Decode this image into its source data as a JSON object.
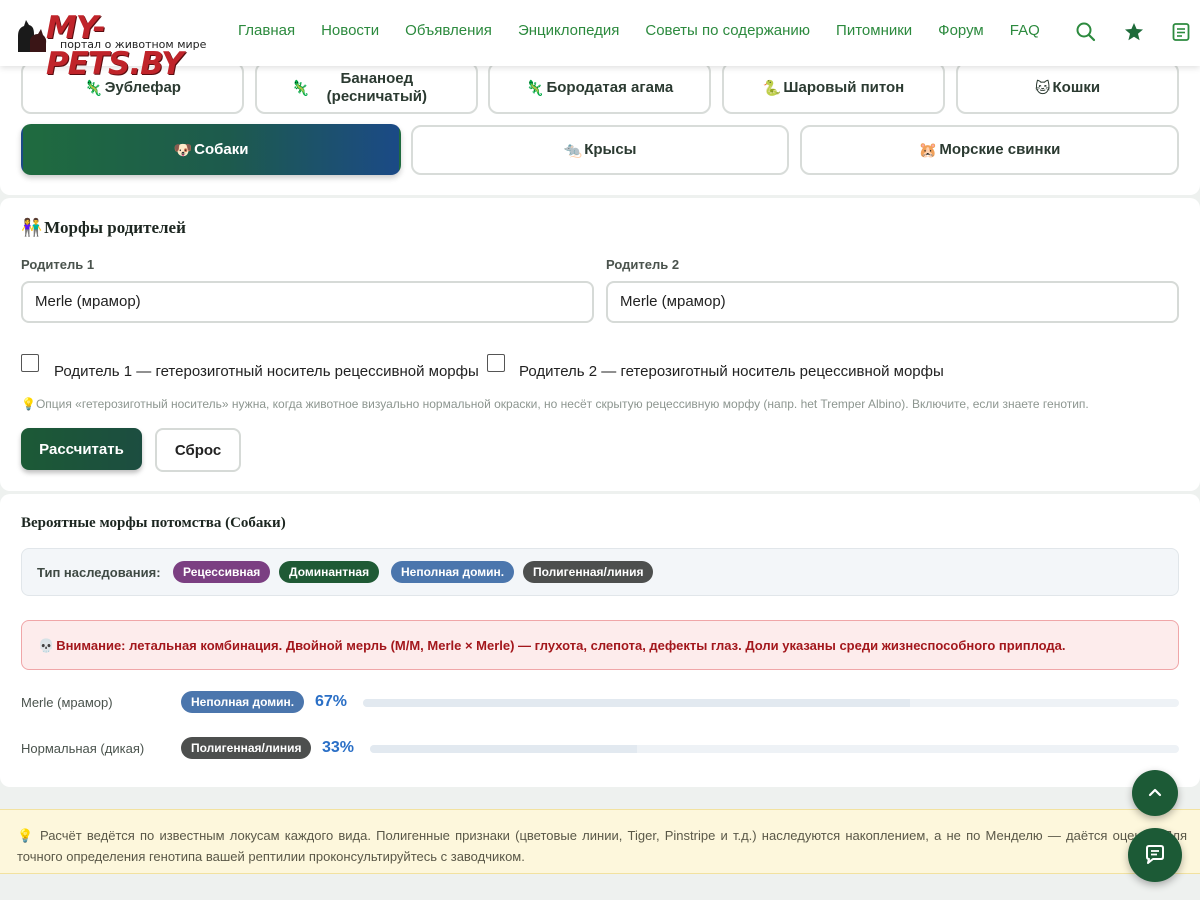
{
  "header": {
    "logo_text": "MY-PETS.BY",
    "logo_subtitle": "портал о животном мире",
    "nav": [
      "Главная",
      "Новости",
      "Объявления",
      "Энциклопедия",
      "Советы по содержанию",
      "Питомники",
      "Форум",
      "FAQ"
    ],
    "icons": [
      "search-icon",
      "star-icon",
      "notes-icon"
    ],
    "accent_color": "#2c8a3e"
  },
  "species": {
    "row1": [
      {
        "emoji": "🦎",
        "label": "Эублефар"
      },
      {
        "emoji": "🦎",
        "label": "Бананоед (ресничатый)"
      },
      {
        "emoji": "🦎",
        "label": "Бородатая агама"
      },
      {
        "emoji": "🐍",
        "label": "Шаровый питон"
      },
      {
        "emoji": "🐱",
        "label": "Кошки"
      }
    ],
    "row2": [
      {
        "emoji": "🐶",
        "label": "Собаки",
        "active": true
      },
      {
        "emoji": "🐀",
        "label": "Крысы"
      },
      {
        "emoji": "🐹",
        "label": "Морские свинки"
      }
    ]
  },
  "parents": {
    "title_emoji": "👫",
    "title": "Морфы родителей",
    "parent1_label": "Родитель 1",
    "parent1_value": "Merle (мрамор)",
    "parent2_label": "Родитель 2",
    "parent2_value": "Merle (мрамор)",
    "het1_label": "Родитель 1 — гетерозиготный носитель рецессивной морфы",
    "het2_label": "Родитель 2 — гетерозиготный носитель рецессивной морфы",
    "hint": "💡Опция «гетерозиготный носитель» нужна, когда животное визуально нормальной окраски, но несёт скрытую рецессивную морфу (напр. het Tremper Albino). Включите, если знаете генотип.",
    "calc_button": "Рассчитать",
    "reset_button": "Сброс"
  },
  "results": {
    "title": "Вероятные морфы потомства (Собаки)",
    "legend_label": "Тип наследования:",
    "legend": [
      {
        "label": "Рецессивная",
        "color": "#7b3f82"
      },
      {
        "label": "Доминантная",
        "color": "#1f5a35"
      },
      {
        "label": "Неполная домин.",
        "color": "#4b76ad"
      },
      {
        "label": "Полигенная/линия",
        "color": "#4d4f4e"
      }
    ],
    "warning_emoji": "💀",
    "warning": "Внимание: летальная комбинация. Двойной мерль (M/M, Merle × Merle) — глухота, слепота, дефекты глаз. Доли указаны среди жизнеспособного приплода.",
    "rows": [
      {
        "label": "Merle (мрамор)",
        "type": "Неполная домин.",
        "type_color": "#4b76ad",
        "percent": "67%",
        "fraction": 0.67
      },
      {
        "label": "Нормальная (дикая)",
        "type": "Полигенная/линия",
        "type_color": "#4d4f4e",
        "percent": "33%",
        "fraction": 0.33
      }
    ]
  },
  "note": {
    "text": "💡 Расчёт ведётся по известным локусам каждого вида. Полигенные признаки (цветовые линии, Tiger, Pinstripe и т.д.) наследуются накоплением, а не по Менделю — даётся оценка. Для точного определения генотипа вашей рептилии проконсультируйтесь с заводчиком."
  },
  "fabs": [
    "scroll-top-icon",
    "chat-icon"
  ]
}
